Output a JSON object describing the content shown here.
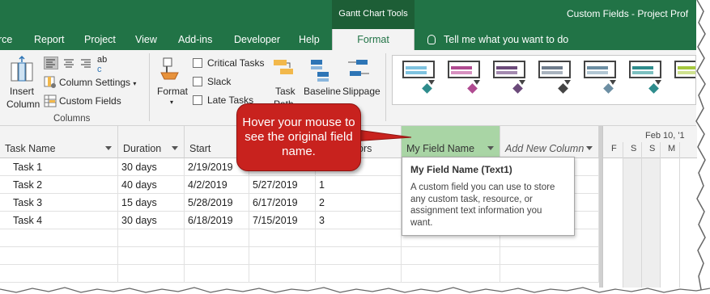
{
  "title_bar": {
    "context_tools": "Gantt Chart Tools",
    "app_title": "Custom Fields  -  Project Prof"
  },
  "tabs": [
    {
      "label": "rce"
    },
    {
      "label": "Report"
    },
    {
      "label": "Project"
    },
    {
      "label": "View"
    },
    {
      "label": "Add-ins"
    },
    {
      "label": "Developer"
    },
    {
      "label": "Help"
    },
    {
      "label": "Format",
      "active": true
    }
  ],
  "tell_me": "Tell me what you want to do",
  "ribbon": {
    "insert_column": "Insert\nColumn",
    "insert_line1": "Insert",
    "insert_line2": "Column",
    "abc": "ab",
    "abc2": "c",
    "column_settings": "Column Settings",
    "custom_fields": "Custom Fields",
    "columns_group": "Columns",
    "format_label": "Format",
    "critical_tasks": "Critical Tasks",
    "slack": "Slack",
    "late_tasks": "Late Tasks",
    "task_paths_1": "Task",
    "task_paths_2": "Path",
    "baseline": "Baseline",
    "slippage": "Slippage"
  },
  "gallery_colors": [
    "#7fc3e0",
    "#b04b91",
    "#6b4a7a",
    "#6f7c8c",
    "#6c8ea3",
    "#2e8c8c",
    "#a6c83d"
  ],
  "grid": {
    "headers": {
      "task_name": "Task Name",
      "duration": "Duration",
      "start": "Start",
      "predecessors": "ors",
      "my_field": "My Field Name",
      "add_new": "Add New Column"
    },
    "rows": [
      {
        "name": "Task 1",
        "duration": "30 days",
        "start": "2/19/2019",
        "finish": "",
        "pred": ""
      },
      {
        "name": "Task 2",
        "duration": "40 days",
        "start": "4/2/2019",
        "finish": "5/27/2019",
        "pred": "1"
      },
      {
        "name": "Task 3",
        "duration": "15 days",
        "start": "5/28/2019",
        "finish": "6/17/2019",
        "pred": "2"
      },
      {
        "name": "Task 4",
        "duration": "30 days",
        "start": "6/18/2019",
        "finish": "7/15/2019",
        "pred": "3"
      }
    ]
  },
  "timescale": {
    "week": "Feb 10, '1",
    "days": [
      "F",
      "S",
      "S",
      "M"
    ]
  },
  "tooltip": {
    "title": "My Field Name (Text1)",
    "body": "A custom field you can use to store any custom task, resource, or assignment text information you want."
  },
  "callout": {
    "text": "Hover your mouse to see the original field name."
  }
}
